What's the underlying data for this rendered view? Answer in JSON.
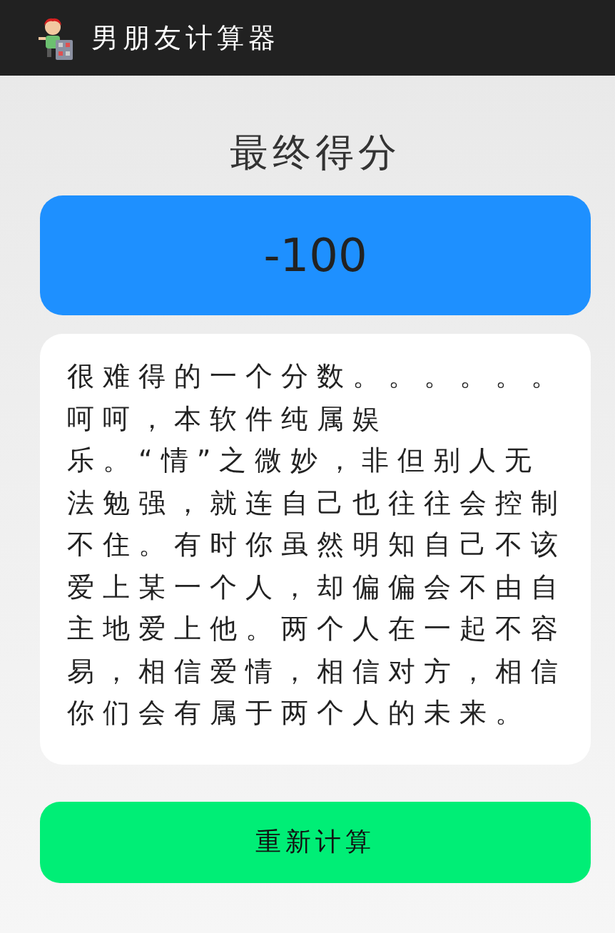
{
  "app_bar": {
    "title": "男朋友计算器"
  },
  "heading": "最终得分",
  "score": "-100",
  "message": "很难得的一个分数。。。。。。呵呵，本软件纯属娱乐。“情”之微妙，非但别人无法勉强，就连自己也往往会控制不住。有时你虽然明知自己不该爱上某一个人，却偏偏会不由自主地爱上他。两个人在一起不容易，相信爱情，相信对方，相信你们会有属于两个人的未来。",
  "buttons": [
    "重新计算"
  ]
}
